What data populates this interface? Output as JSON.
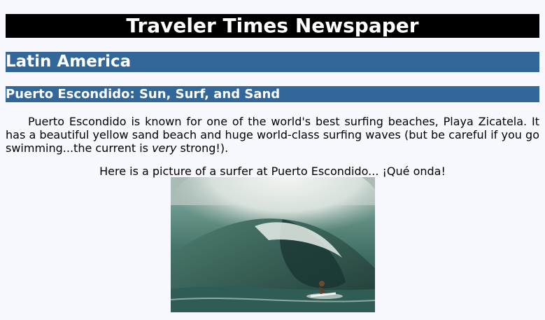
{
  "masthead": {
    "title": "Traveler Times Newspaper"
  },
  "section": {
    "title": "Latin America"
  },
  "article": {
    "headline": "Puerto Escondido: Sun, Surf, and Sand",
    "body_part1": "Puerto Escondido is known for one of the world's best surfing beaches, Playa Zicatela. It has a beautiful yellow sand beach and huge world-class surfing waves (but be careful if you go swimming...the current is ",
    "body_emphasis": "very",
    "body_part2": " strong!).",
    "caption": "Here is a picture of a surfer at Puerto Escondido... ¡Qué onda!"
  },
  "colors": {
    "page_background": "#f7f8fe",
    "masthead_background": "#000000",
    "section_bar": "#336699",
    "bar_text": "#ffffff"
  }
}
